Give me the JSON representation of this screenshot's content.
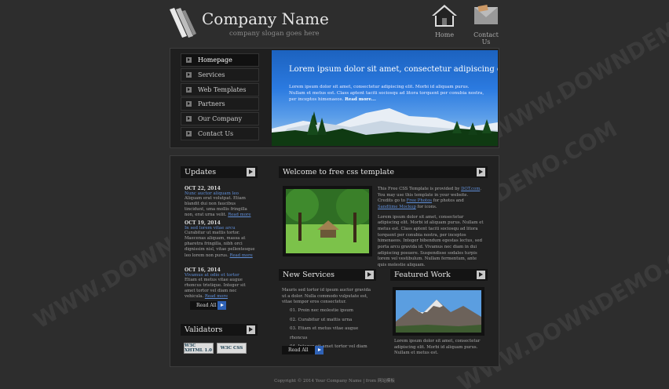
{
  "header": {
    "company_name": "Company Name",
    "slogan": "company slogan goes here",
    "links": [
      {
        "label": "Home",
        "icon": "home-icon"
      },
      {
        "label": "Contact Us",
        "icon": "mail-icon"
      }
    ]
  },
  "nav": {
    "items": [
      {
        "label": "Homepage",
        "active": true
      },
      {
        "label": "Services"
      },
      {
        "label": "Web Templates"
      },
      {
        "label": "Partners"
      },
      {
        "label": "Our Company"
      },
      {
        "label": "Contact Us"
      }
    ]
  },
  "banner": {
    "title": "Lorem ipsum dolor sit amet, consectetur adipiscing elit",
    "text": "Lorem ipsum dolor sit amet, consectetur adipiscing elit. Morbi id aliquam purus. Nullam et metus est. Class aptent taciti sociosqu ad litora torquent per conubia nostra, per inceptos himenaeos.",
    "read_more": "Read more..."
  },
  "updates": {
    "title": "Updates",
    "items": [
      {
        "date": "OCT 22, 2014",
        "title": "Nunc auctor aliquam leo",
        "body": "Aliquam erat volutpat. Etiam blandit dui non faucibus tincidunt, uma mollis fringilla non, erat urna velit.",
        "more": "Read more"
      },
      {
        "date": "OCT 19, 2014",
        "title": "In sed lorem vitae arcu",
        "body": "Curabitur ut mattis tortor. Maecenas aliquam, massa at pharetra fringilla, nibh orci dignissim nisl, vitae pellentesque leo lorem non purus.",
        "more": "Read more"
      },
      {
        "date": "OCT 16, 2014",
        "title": "Vivamus at odio et tortor",
        "body": "Etiam et metus vitae augue rhoncus tristique. Integer sit amet tortor vel diam nec vehicula.",
        "more": "Read more"
      }
    ],
    "read_all": "Read All"
  },
  "validators": {
    "title": "Validators",
    "badges": [
      "W3C XHTML 1.0",
      "W3C CSS"
    ]
  },
  "welcome": {
    "title": "Welcome to free css template",
    "para1_prefix": "This Free CSS Template is provided by ",
    "para1_link1": "DOT.com",
    "para1_mid": ". You may use this template in your website. Credits go to ",
    "para1_link2": "Free Photos",
    "para1_mid2": " for photos and ",
    "para1_link3": "Sandtime Mockup",
    "para1_suffix": " for icons.",
    "para2": "Lorem ipsum dolor sit amet, consectetur adipiscing elit. Morbi id aliquam purus. Nullam et metus est. Class aptent taciti sociosqu ad litora torquent per conubia nostra, per inceptos himenaeos. Integer bibendum egestas lectus, sed porta arcu gravida id. Vivamus nec diam in dui adipiscing posuere. Suspendisse sodales turpis lorem vel vestibulum. Nullam fermentum, ante quis molestie aliquam."
  },
  "new_services": {
    "title": "New Services",
    "text": "Mauris sed tortor id ipsum auctor gravida ut a dolor. Nulla commodo vulputate est, vitae tempor eros consectetur.",
    "items": [
      "01. Proin nec molestie ipsum",
      "02. Curabitur ut mattis urna",
      "03. Etiam et metus vitae augue rhoncus",
      "04. Integer sit amet tortor vel diam"
    ],
    "read_all": "Read All"
  },
  "featured": {
    "title": "Featured Work",
    "caption": "Lorem ipsum dolor sit amet, consectetur adipiscing elit. Morbi id aliquam purus. Nullam et metus est."
  },
  "footer": {
    "text": "Copyright © 2014 Your Company Name | from 网站模板"
  },
  "watermark": "WWW.DOWNDEMO.COM",
  "colors": {
    "link": "#5f8ed8",
    "banner_sky": "#2b7ae0",
    "accent_button": "#2f62b6"
  }
}
